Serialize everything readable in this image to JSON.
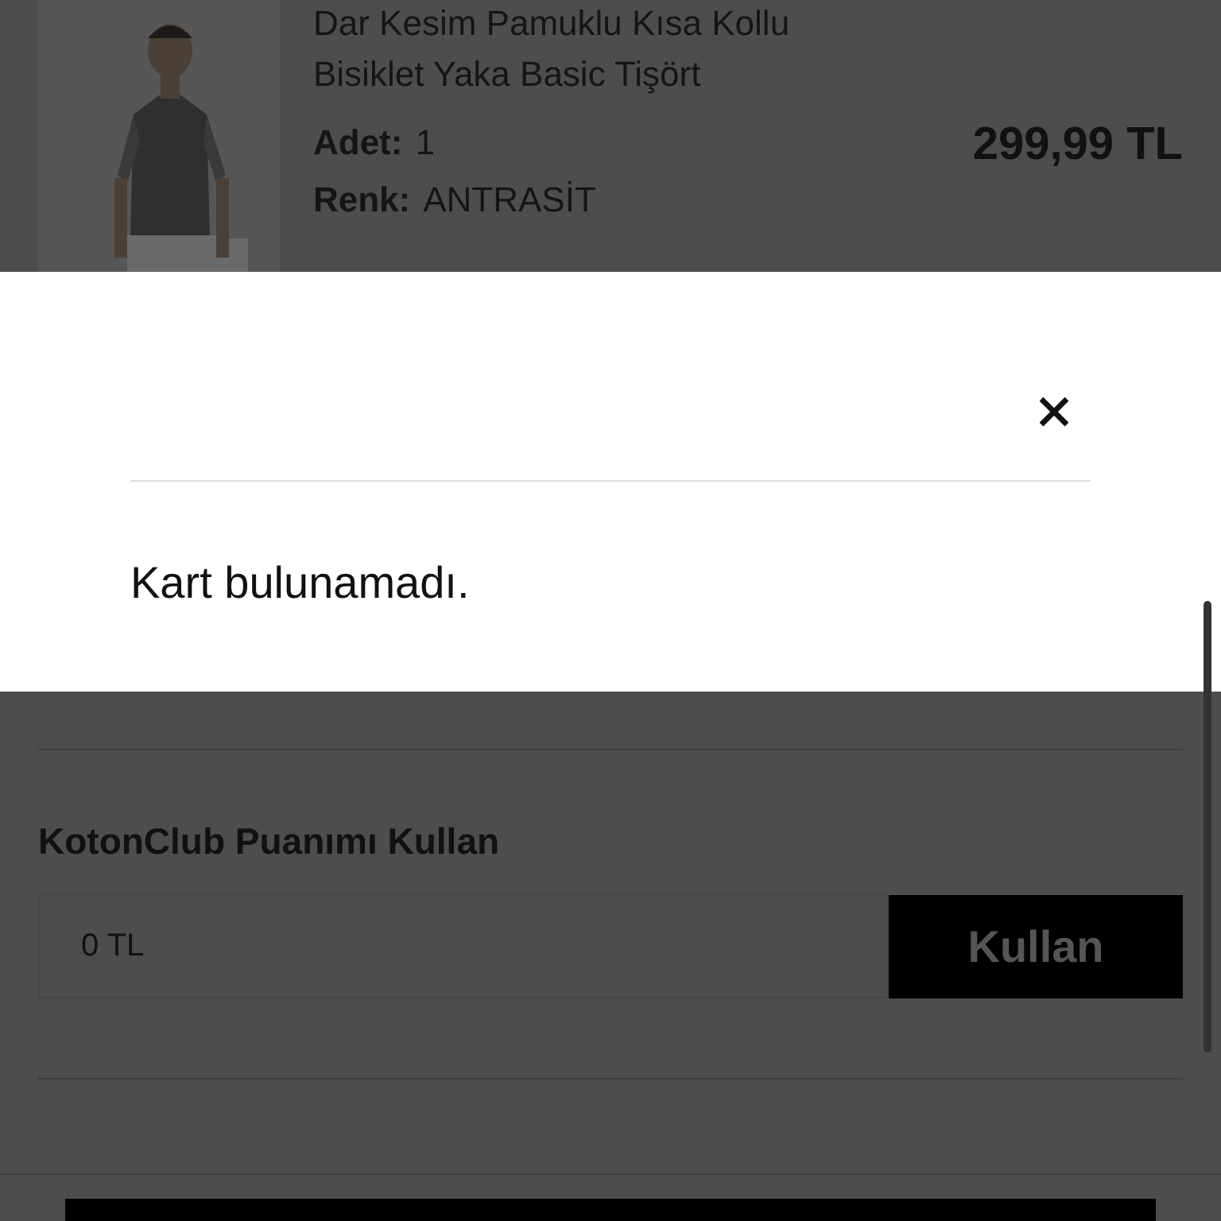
{
  "product": {
    "title": "Dar Kesim Pamuklu Kısa Kollu Bisiklet Yaka Basic Tişört",
    "quantity_label": "Adet:",
    "quantity": "1",
    "color_label": "Renk:",
    "colour_value": "ANTRASİT",
    "price": "299,99 TL"
  },
  "modal": {
    "message": "Kart bulunamadı."
  },
  "points": {
    "title": "KotonClub Puanımı Kullan",
    "value": "0 TL",
    "button": "Kullan"
  }
}
